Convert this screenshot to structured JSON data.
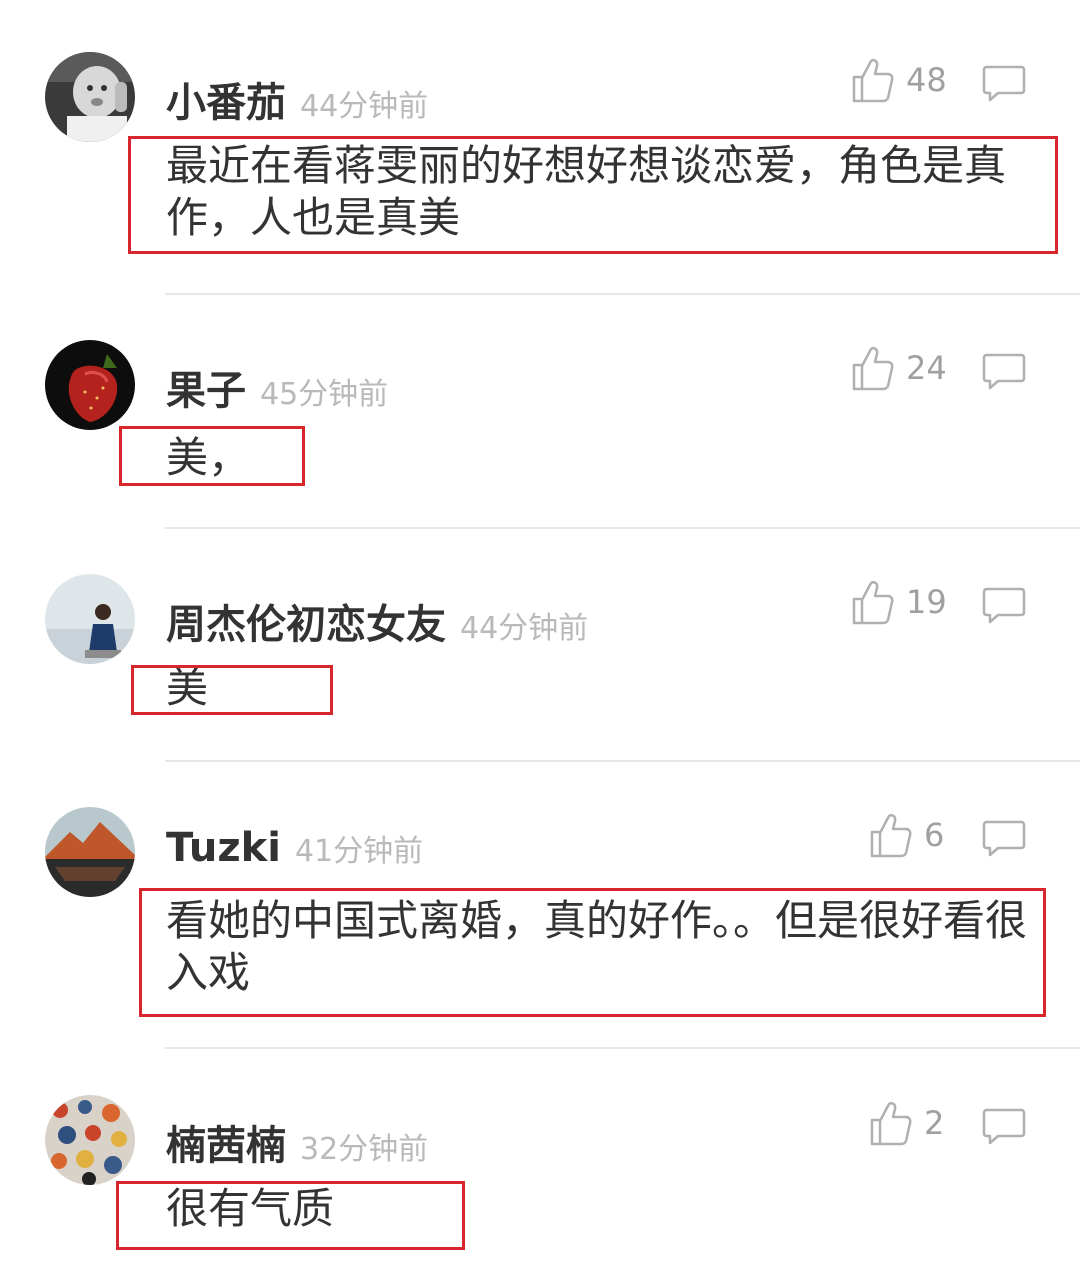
{
  "comments": [
    {
      "username": "小番茄",
      "time": "44分钟前",
      "likes": "48",
      "text": "最近在看蒋雯丽的好想好想谈恋爱，角色是真作，人也是真美",
      "avatar_icon": "baby-photo-avatar"
    },
    {
      "username": "果子",
      "time": "45分钟前",
      "likes": "24",
      "text": "美，",
      "avatar_icon": "strawberry-avatar"
    },
    {
      "username": "周杰伦初恋女友",
      "time": "44分钟前",
      "likes": "19",
      "text": "美",
      "avatar_icon": "person-photo-avatar"
    },
    {
      "username": "Tuzki",
      "time": "41分钟前",
      "likes": "6",
      "text": "看她的中国式离婚，真的好作。。但是很好看很入戏",
      "avatar_icon": "mountain-lake-avatar"
    },
    {
      "username": "楠茜楠",
      "time": "32分钟前",
      "likes": "2",
      "text": "很有气质",
      "avatar_icon": "floral-pattern-avatar"
    }
  ],
  "colors": {
    "highlight_border": "#d7262e",
    "username": "#333333",
    "timestamp": "#b9b9b9",
    "divider": "#e6e6e6"
  },
  "icons": {
    "like": "thumbs-up-icon",
    "reply": "speech-bubble-icon"
  }
}
